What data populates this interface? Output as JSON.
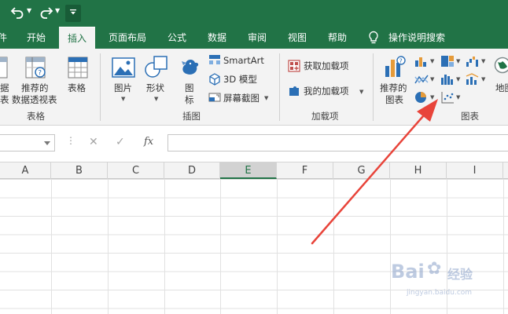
{
  "titlebar": {
    "undo_icon": "undo-icon",
    "redo_icon": "redo-icon",
    "customize_icon": "customize-quick-access-icon",
    "background": "#217346"
  },
  "tabs": [
    {
      "label": "件",
      "active": false
    },
    {
      "label": "开始",
      "active": false
    },
    {
      "label": "插入",
      "active": true
    },
    {
      "label": "页面布局",
      "active": false
    },
    {
      "label": "公式",
      "active": false
    },
    {
      "label": "数据",
      "active": false
    },
    {
      "label": "审阅",
      "active": false
    },
    {
      "label": "视图",
      "active": false
    },
    {
      "label": "帮助",
      "active": false
    }
  ],
  "tell_me": {
    "label": "操作说明搜索",
    "icon": "lightbulb-icon"
  },
  "ribbon": {
    "tables_group": {
      "label": "表格",
      "pivot_partial_top": "据",
      "pivot_partial_bottom": "表",
      "recommended_pivot_line1": "推荐的",
      "recommended_pivot_line2": "数据透视表",
      "table_label": "表格"
    },
    "illustrations_group": {
      "label": "插图",
      "pictures": "图片",
      "shapes": "形状",
      "icons_line1": "图",
      "icons_line2": "标",
      "smartart": "SmartArt",
      "model3d": "3D 模型",
      "screenshot": "屏幕截图"
    },
    "addins_group": {
      "label": "加载项",
      "get_addins": "获取加载项",
      "my_addins": "我的加载项"
    },
    "charts_group": {
      "label": "图表",
      "recommended_line1": "推荐的",
      "recommended_line2": "图表",
      "maps_partial": "地图"
    }
  },
  "formula_bar": {
    "cancel_icon": "✕",
    "enter_icon": "✓",
    "fx_label": "fx",
    "name_value": "",
    "formula_value": ""
  },
  "columns": [
    "A",
    "B",
    "C",
    "D",
    "E",
    "F",
    "G",
    "H",
    "I"
  ],
  "selected_column": "E",
  "annotation": {
    "color": "#e8443a",
    "meaning": "red arrow pointing to the charts group"
  },
  "watermark": {
    "brand": "Bai",
    "suffix": "经验",
    "url": "jingyan.baidu.com"
  }
}
